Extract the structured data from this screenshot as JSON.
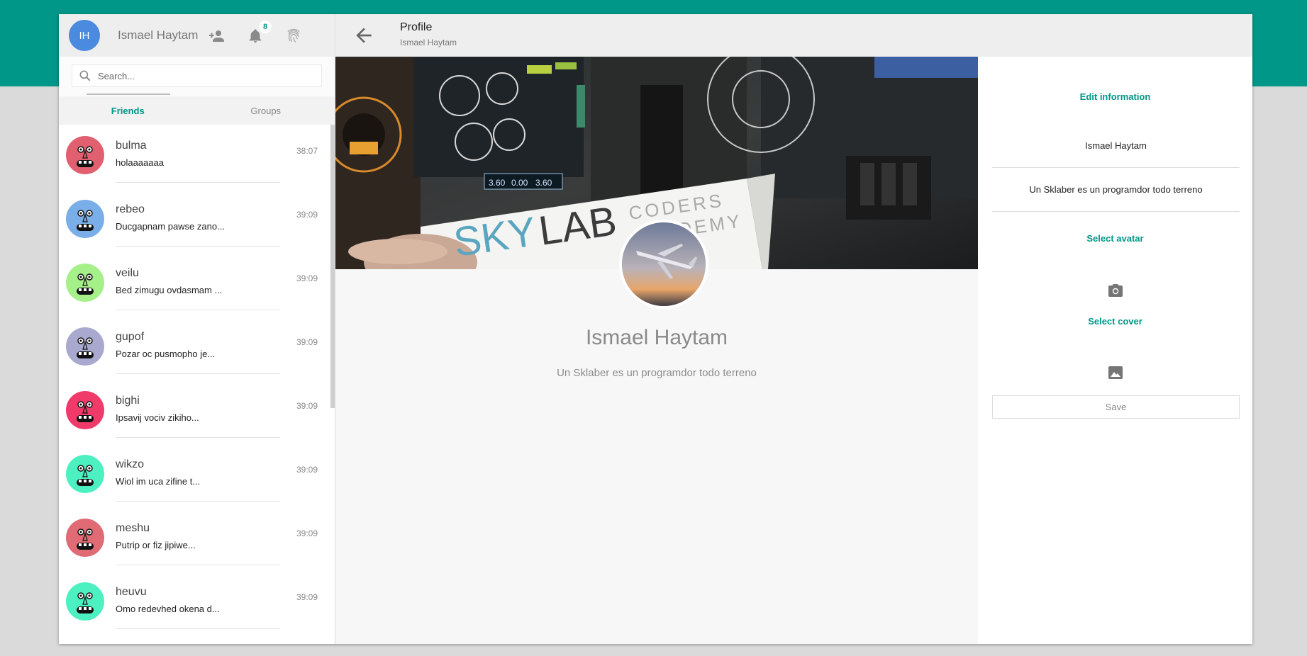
{
  "left_header": {
    "avatar_initials": "IH",
    "user_name": "Ismael Haytam",
    "add_friend_icon": "person-add-icon",
    "notifications_icon": "bell-icon",
    "notifications_count": "8",
    "fingerprint_icon": "fingerprint-icon"
  },
  "search": {
    "placeholder": "Search..."
  },
  "tabs": [
    {
      "label": "Friends",
      "active": true
    },
    {
      "label": "Groups",
      "active": false
    }
  ],
  "chats": [
    {
      "name": "bulma",
      "message": "holaaaaaaa",
      "time": "38:07",
      "color": "#e06070"
    },
    {
      "name": "rebeo",
      "message": "Ducgapnam pawse zano...",
      "time": "39:09",
      "color": "#7aaee8"
    },
    {
      "name": "veilu",
      "message": "Bed zimugu ovdasmam ...",
      "time": "39:09",
      "color": "#a6f08a"
    },
    {
      "name": "gupof",
      "message": "Pozar oc pusmopho je...",
      "time": "39:09",
      "color": "#a9a9cf"
    },
    {
      "name": "bighi",
      "message": "Ipsavij vociv zikiho...",
      "time": "39:09",
      "color": "#f03a6a"
    },
    {
      "name": "wikzo",
      "message": "Wiol im uca zifine t...",
      "time": "39:09",
      "color": "#4df0c0"
    },
    {
      "name": "meshu",
      "message": "Putrip or fiz jipiwe...",
      "time": "39:09",
      "color": "#e06b75"
    },
    {
      "name": "heuvu",
      "message": "Omo redevhed okena d...",
      "time": "39:09",
      "color": "#4df0c0"
    }
  ],
  "topbar": {
    "title": "Profile",
    "subtitle": "Ismael Haytam",
    "back_icon": "arrow-back-icon"
  },
  "cover": {
    "banner_word_1": "SKY",
    "banner_word_2": "LAB",
    "banner_word_3": "CODERS",
    "banner_word_4": "ACADEMY",
    "gauge_1": "3.60",
    "gauge_2": "0.00",
    "gauge_3": "3.60"
  },
  "profile": {
    "name": "Ismael Haytam",
    "bio": "Un Sklaber es un programdor todo terreno"
  },
  "edit": {
    "heading": "Edit information",
    "name_value": "Ismael Haytam",
    "bio_value": "Un Sklaber es un programdor todo terreno",
    "select_avatar": "Select avatar",
    "avatar_icon": "camera-icon",
    "select_cover": "Select cover",
    "cover_icon": "image-icon",
    "save_label": "Save"
  },
  "colors": {
    "accent": "#009688",
    "avatar_blue": "#4a8be0"
  }
}
